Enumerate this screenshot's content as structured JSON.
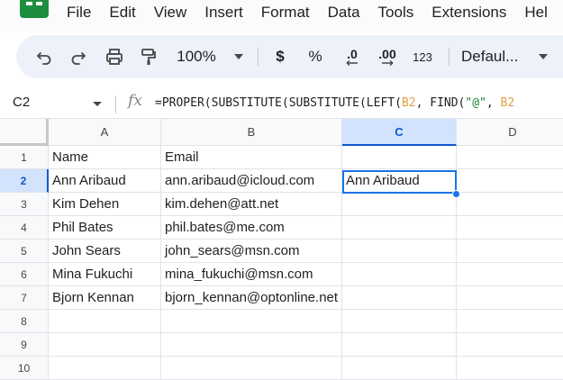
{
  "menu": [
    "File",
    "Edit",
    "View",
    "Insert",
    "Format",
    "Data",
    "Tools",
    "Extensions",
    "Hel"
  ],
  "toolbar": {
    "zoom": "100%",
    "currency": "$",
    "percent": "%",
    "decrease_decimal": ".0",
    "increase_decimal": ".00",
    "number_format": "123",
    "font": "Defaul..."
  },
  "formula_bar": {
    "name_box": "C2",
    "fx": "fx",
    "formula_prefix": "=PROPER(SUBSTITUTE(SUBSTITUTE(LEFT(",
    "ref1": "B2",
    "formula_mid": ", FIND(",
    "string": "\"@\"",
    "formula_mid2": ", ",
    "ref2": "B2"
  },
  "columns": [
    "A",
    "B",
    "C",
    "D"
  ],
  "rows": [
    "1",
    "2",
    "3",
    "4",
    "5",
    "6",
    "7",
    "8",
    "9",
    "10"
  ],
  "cells": {
    "A": [
      "Name",
      "Ann Aribaud",
      "Kim Dehen",
      "Phil Bates",
      "John Sears",
      "Mina Fukuchi",
      "Bjorn Kennan",
      "",
      "",
      ""
    ],
    "B": [
      "Email",
      "ann.aribaud@icloud.com",
      "kim.dehen@att.net",
      "phil.bates@me.com",
      "john_sears@msn.com",
      "mina_fukuchi@msn.com",
      "bjorn_kennan@optonline.net",
      "",
      "",
      ""
    ],
    "C": [
      "",
      "Ann Aribaud",
      "",
      "",
      "",
      "",
      "",
      "",
      "",
      ""
    ]
  },
  "selection": {
    "column": "C",
    "row": "2"
  },
  "icons": [
    "sheets-logo",
    "undo-icon",
    "redo-icon",
    "print-icon",
    "paint-format-icon",
    "chevron-down-icon",
    "fx-icon"
  ],
  "colors": {
    "accent": "#1a73e8",
    "selection_header": "#d3e3fd",
    "toolbar_bg": "#edf2fa",
    "logo_green": "#1e8e3e"
  }
}
